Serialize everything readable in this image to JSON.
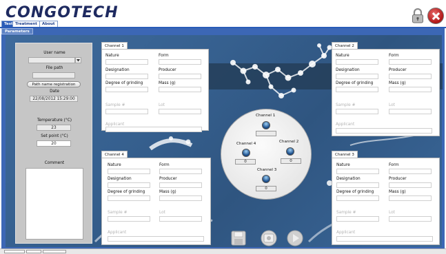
{
  "app": {
    "logo_text": "CONGOTECH"
  },
  "top_tabs": [
    {
      "label": "Test"
    },
    {
      "label": "Treatment"
    },
    {
      "label": "About"
    }
  ],
  "sub_tab": {
    "label": "Parameters"
  },
  "left_panel": {
    "user_name_label": "User name",
    "user_name_value": "",
    "file_path_label": "File path",
    "file_path_value": "",
    "path_button_label": "Path name registration",
    "date_label": "Date",
    "date_value": "22/08/2012 15:29:00",
    "temperature_label": "Temperature (°C)",
    "temperature_value": "23",
    "set_point_label": "Set point (°C)",
    "set_point_value": "20",
    "comment_label": "Comment",
    "comment_value": ""
  },
  "field_labels": {
    "nature": "Nature",
    "form": "Form",
    "designation": "Designation",
    "producer": "Producer",
    "degree_of_grinding": "Degree of grinding",
    "mass": "Mass (g)",
    "sample": "Sample #",
    "lot": "Lot",
    "applicant": "Applicant"
  },
  "channels": [
    {
      "tab": "Channel 1"
    },
    {
      "tab": "Channel 2"
    },
    {
      "tab": "Channel 3"
    },
    {
      "tab": "Channel 4"
    }
  ],
  "selector": {
    "channel1": {
      "label": "Channel 1",
      "value": ""
    },
    "channel2": {
      "label": "Channel 2",
      "value": "0"
    },
    "channel3": {
      "label": "Channel 3",
      "value": "0"
    },
    "channel4": {
      "label": "Channel 4",
      "value": "0"
    }
  },
  "colors": {
    "accent_blue": "#2a5cb8",
    "background_blue": "#3c67b5",
    "close_red": "#c12020"
  },
  "icons": [
    "lock-icon",
    "close-icon",
    "dropdown-icon",
    "save-icon",
    "settings-icon",
    "play-icon"
  ]
}
